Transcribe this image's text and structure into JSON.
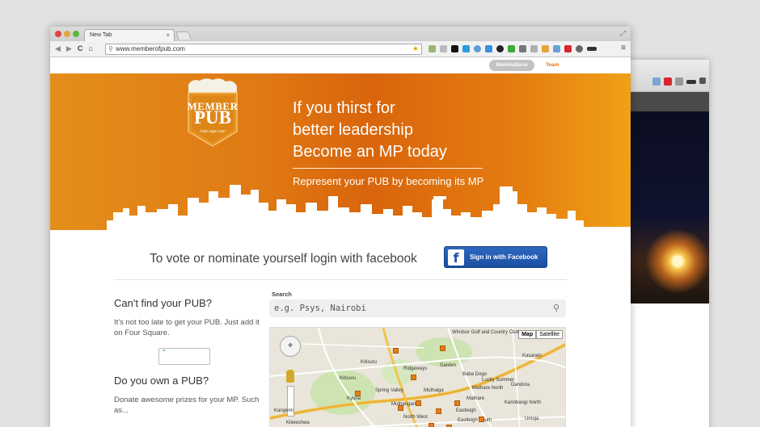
{
  "browser": {
    "tab_title": "New Tab",
    "url": "www.memberofpub.com"
  },
  "site": {
    "nav": {
      "nominations_label": "Nominations",
      "team_label": "Team"
    },
    "logo": {
      "word1": "MEMBER",
      "word2": "of",
      "word3": "PUB",
      "tagline": "Fubo eiger nam"
    },
    "hero": {
      "headline_line1": "If you thirst for",
      "headline_line2": "better leadership",
      "headline_line3": "Become an MP today",
      "subline": "Represent your PUB by becoming its MP"
    },
    "login": {
      "prompt": "To vote or nominate yourself login with facebook",
      "fb_button": "Sign in with Facebook",
      "fb_letter": "f"
    },
    "left": {
      "cant_find_title": "Can't find your PUB?",
      "cant_find_text": "It's not too late to get your PUB. Just add it on Four Square.",
      "own_title": "Do you own a PUB?",
      "own_text": "Donate awesome prizes for your MP. Such as..."
    },
    "search": {
      "label": "Search",
      "placeholder": "e.g. Psys, Nairobi"
    },
    "map": {
      "map_btn": "Map",
      "satellite_btn": "Satellite",
      "labels": [
        "Windsor Golf and Country Club",
        "Kasarani",
        "Kitisuru",
        "Kitisuru",
        "Ridgeways",
        "Garden",
        "Baba Dogo",
        "Lucky Summer",
        "Kileleshwa",
        "Spring Valley",
        "Muthaiga",
        "Mathare",
        "Dandora",
        "Mathare North",
        "Muthangari",
        "Kangemi",
        "Kyuna",
        "North West",
        "Eastleigh",
        "Kariobangi North",
        "Umoja",
        "Eastleigh South"
      ]
    }
  }
}
